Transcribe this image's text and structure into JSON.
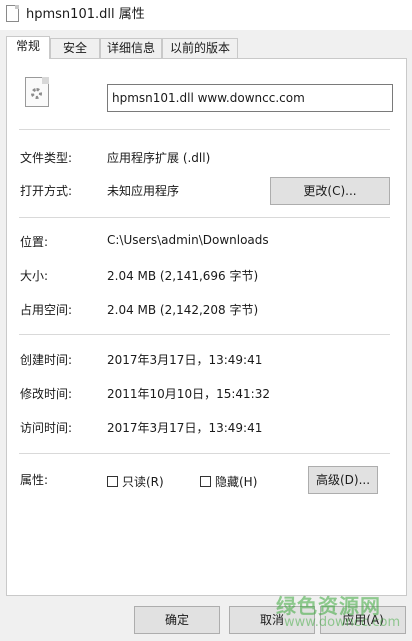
{
  "window": {
    "title": "hpmsn101.dll 属性"
  },
  "tabs": [
    {
      "label": "常规",
      "active": true
    },
    {
      "label": "安全",
      "active": false
    },
    {
      "label": "详细信息",
      "active": false
    },
    {
      "label": "以前的版本",
      "active": false
    }
  ],
  "file": {
    "icon": "dll-file-gear-icon",
    "name_value": "hpmsn101.dll    www.downcc.com"
  },
  "general": {
    "type_label": "文件类型:",
    "type_value": "应用程序扩展 (.dll)",
    "opens_with_label": "打开方式:",
    "opens_with_value": "未知应用程序",
    "change_button": "更改(C)..."
  },
  "location": {
    "location_label": "位置:",
    "location_value": "C:\\Users\\admin\\Downloads",
    "size_label": "大小:",
    "size_value": "2.04 MB (2,141,696 字节)",
    "size_on_disk_label": "占用空间:",
    "size_on_disk_value": "2.04 MB (2,142,208 字节)"
  },
  "dates": {
    "created_label": "创建时间:",
    "created_value": "2017年3月17日，13:49:41",
    "modified_label": "修改时间:",
    "modified_value": "2011年10月10日，15:41:32",
    "accessed_label": "访问时间:",
    "accessed_value": "2017年3月17日，13:49:41"
  },
  "attributes": {
    "label": "属性:",
    "readonly_label": "只读(R)",
    "readonly_checked": false,
    "hidden_label": "隐藏(H)",
    "hidden_checked": false,
    "advanced_button": "高级(D)..."
  },
  "footer": {
    "ok": "确定",
    "cancel": "取消",
    "apply": "应用(A)"
  },
  "watermark": {
    "text": "绿色资源网",
    "url": "www.downcc.com"
  },
  "colors": {
    "window_bg": "#f0f0f0",
    "panel_bg": "#ffffff",
    "button_bg": "#e1e1e1",
    "watermark": "#3caa3c"
  }
}
